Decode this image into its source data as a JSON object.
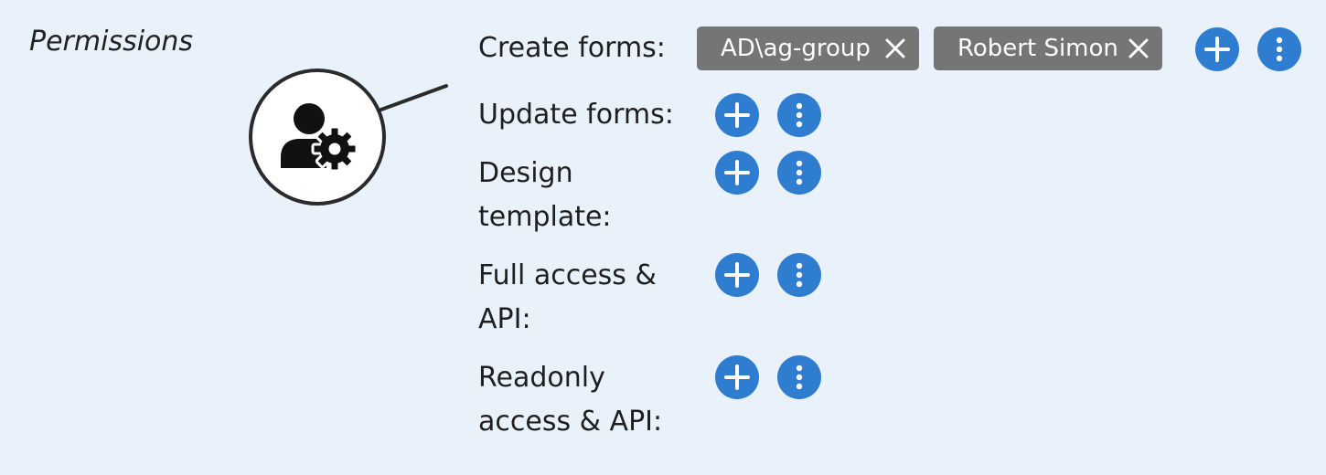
{
  "section": {
    "title": "Permissions"
  },
  "permissions": {
    "create_forms": {
      "label": "Create forms:",
      "assignees": [
        {
          "name": "AD\\ag-group"
        },
        {
          "name": "Robert Simon"
        }
      ]
    },
    "update_forms": {
      "label": "Update forms:"
    },
    "design_template": {
      "label_line1": "Design",
      "label_line2": "template:"
    },
    "full_access_api": {
      "label_line1": "Full access &",
      "label_line2": "API:"
    },
    "readonly_access_api": {
      "label_line1": "Readonly",
      "label_line2": "access & API:"
    }
  },
  "icons": {
    "callout": "user-settings-icon",
    "add": "plus-icon",
    "more": "more-vertical-icon",
    "remove": "close-icon"
  },
  "colors": {
    "background": "#e9f1fb",
    "accent": "#2e7dd1",
    "chip": "#757575"
  }
}
